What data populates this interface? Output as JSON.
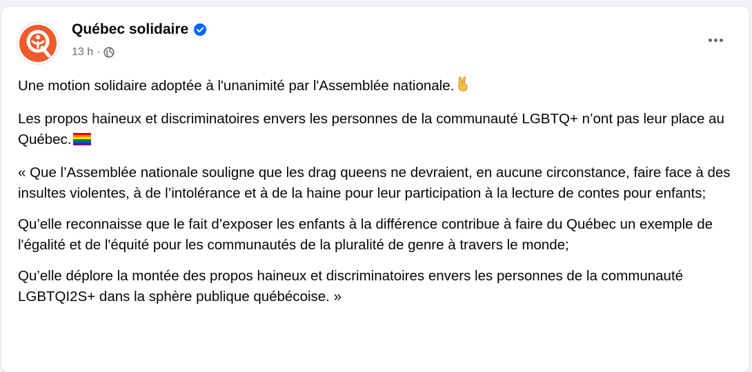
{
  "post": {
    "author": "Québec solidaire",
    "time": "13 h",
    "separator": "·",
    "paragraphs": [
      "Une motion solidaire adoptée à l'unanimité par l'Assemblée nationale.",
      "Les propos haineux et discriminatoires envers les personnes de la communauté LGBTQ+ n’ont pas leur place au Québec.",
      "« Que l’Assemblée nationale souligne que les drag queens ne devraient, en aucune circonstance, faire face à des insultes violentes, à de l’intolérance et à de la haine pour leur participation à la lecture de contes pour enfants;",
      "Qu’elle reconnaisse que le fait d’exposer les enfants à la différence contribue à faire du Québec un exemple de l'égalité et de l'équité pour les communautés de la pluralité de genre à travers le monde;",
      "Qu’elle déplore la montée des propos haineux et discriminatoires envers les personnes de la communauté LGBTQI2S+ dans la sphère publique québécoise. »"
    ],
    "icons": {
      "avatar": "quebec-solidaire-logo",
      "verified": "verified-badge-icon",
      "audience": "globe-icon",
      "more": "more-options-icon",
      "emoji_1": "victory-hand-emoji",
      "emoji_2": "rainbow-flag-emoji"
    },
    "colors": {
      "brand_orange": "#ef5b2a",
      "verified_blue": "#0866ff",
      "meta_gray": "#65676b"
    }
  }
}
